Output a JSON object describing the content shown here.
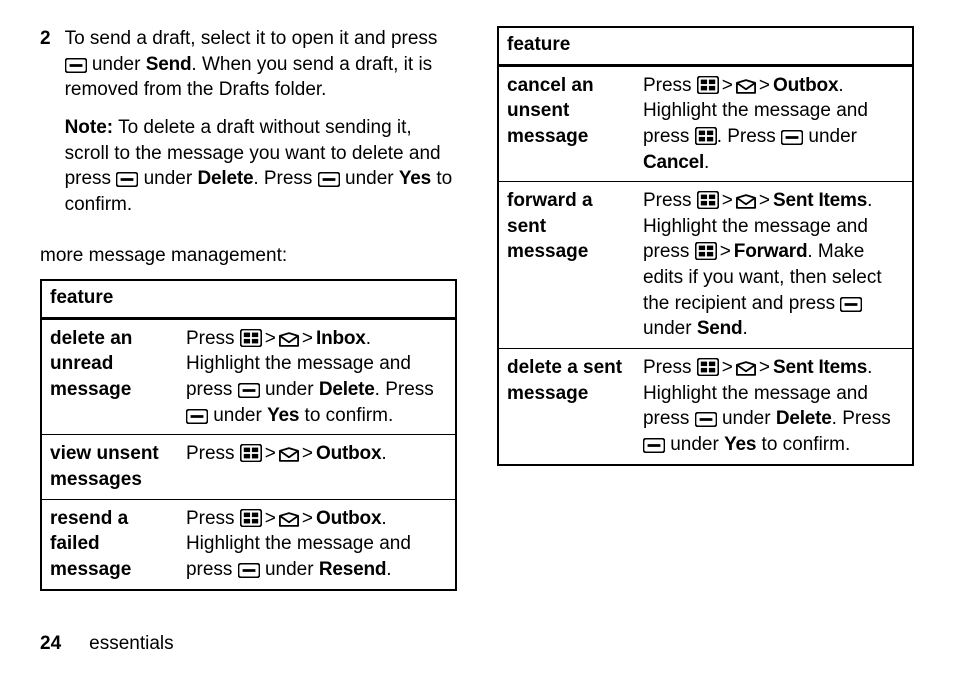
{
  "step": {
    "num": "2",
    "p1a": "To send a draft, select it to open it and press ",
    "p1b": " under ",
    "p1c": "Send",
    "p1d": ". When you send a draft, it is removed from the Drafts folder.",
    "p2a": "Note:",
    "p2b": " To delete a draft without sending it, scroll to the message you want to delete and press ",
    "p2c": " under ",
    "p2d": "Delete",
    "p2e": ". Press ",
    "p2f": " under ",
    "p2g": "Yes",
    "p2h": " to confirm."
  },
  "more_title": "more message management:",
  "gt": ">",
  "t1": {
    "header": "feature",
    "r1": {
      "name": "delete an unread message",
      "a": "Press ",
      "b": "Inbox",
      "c": ". Highlight the message and press ",
      "d": " under ",
      "e": "Delete",
      "f": ". Press ",
      "g": " under ",
      "h": "Yes",
      "i": " to confirm."
    },
    "r2": {
      "name": "view unsent messages",
      "a": "Press ",
      "b": "Outbox",
      "c": "."
    },
    "r3": {
      "name": "resend a failed message",
      "a": "Press ",
      "b": "Outbox",
      "c": ". Highlight the message and press ",
      "d": " under ",
      "e": "Resend",
      "f": "."
    }
  },
  "t2": {
    "header": "feature",
    "r1": {
      "name": "cancel an unsent message",
      "a": "Press ",
      "b": "Outbox",
      "c": ". Highlight the message and press ",
      "d": ". Press ",
      "e": " under ",
      "f": "Cancel",
      "g": "."
    },
    "r2": {
      "name": "forward a sent message",
      "a": "Press ",
      "b": "Sent Items",
      "c": ". Highlight the message and press ",
      "d": "Forward",
      "e": ". Make edits if you want, then select the recipient and press ",
      "f": " under ",
      "g": "Send",
      "h": "."
    },
    "r3": {
      "name": "delete a sent message",
      "a": "Press ",
      "b": "Sent Items",
      "c": ". Highlight the message and press ",
      "d": " under ",
      "e": "Delete",
      "f": ". Press ",
      "g": " under ",
      "h": "Yes",
      "i": " to confirm."
    }
  },
  "footer": {
    "page": "24",
    "section": "essentials"
  }
}
